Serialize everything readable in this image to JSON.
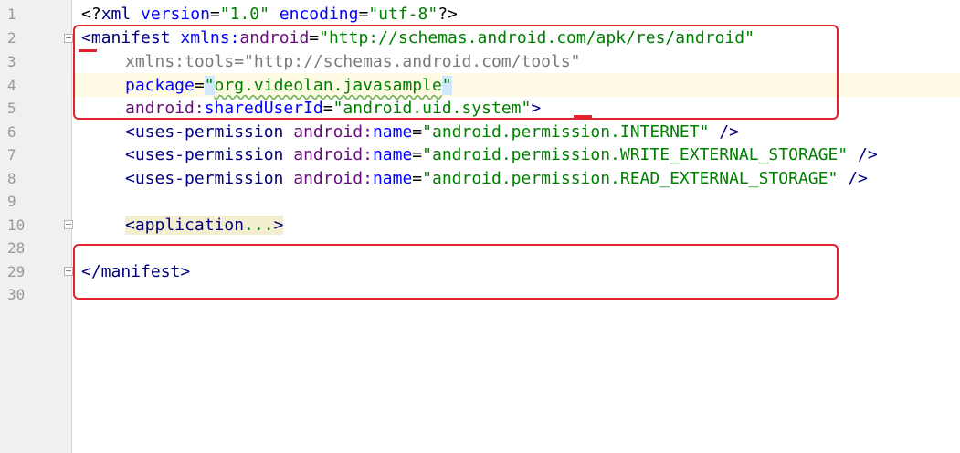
{
  "gutter": {
    "line_numbers": [
      "1",
      "2",
      "3",
      "4",
      "5",
      "6",
      "7",
      "8",
      "9",
      "10",
      "28",
      "29",
      "30"
    ]
  },
  "code": {
    "l1": {
      "open": "<?",
      "kw": "xml",
      "a1": "version",
      "eq": "=",
      "v1": "\"1.0\"",
      "a2": "encoding",
      "v2": "\"utf-8\"",
      "close": "?>"
    },
    "l2": {
      "tag": "<manifest",
      "ns": "xmlns:",
      "attr": "android",
      "eq": "=",
      "val": "\"http://schemas.android.com/apk/res/android\""
    },
    "l3": {
      "text": "xmlns:tools=\"http://schemas.android.com/tools\""
    },
    "l4": {
      "attr": "package",
      "eq": "=",
      "q1": "\"",
      "val": "org.videolan.javasample",
      "q2": "\""
    },
    "l5": {
      "ns": "android:",
      "attr": "sharedUserId",
      "eq": "=",
      "val": "\"android.uid.system\"",
      "close": ">"
    },
    "l6": {
      "tag": "<uses-permission",
      "ns": "android:",
      "attr": "name",
      "eq": "=",
      "val": "\"android.permission.INTERNET\"",
      "close": "/>"
    },
    "l7": {
      "tag": "<uses-permission",
      "ns": "android:",
      "attr": "name",
      "eq": "=",
      "val": "\"android.permission.WRITE_EXTERNAL_STORAGE\"",
      "close": "/>"
    },
    "l8": {
      "tag": "<uses-permission",
      "ns": "android:",
      "attr": "name",
      "eq": "=",
      "val": "\"android.permission.READ_EXTERNAL_STORAGE\"",
      "close": "/>"
    },
    "l10": {
      "tag": "<application",
      "folded": "...",
      "close": ">"
    },
    "l29": {
      "tag": "</manifest>"
    }
  },
  "colors": {
    "annotation": "#e0222e",
    "tag": "#000080",
    "attribute": "#660e7a",
    "namespace": "#0000ff",
    "value": "#008000"
  }
}
